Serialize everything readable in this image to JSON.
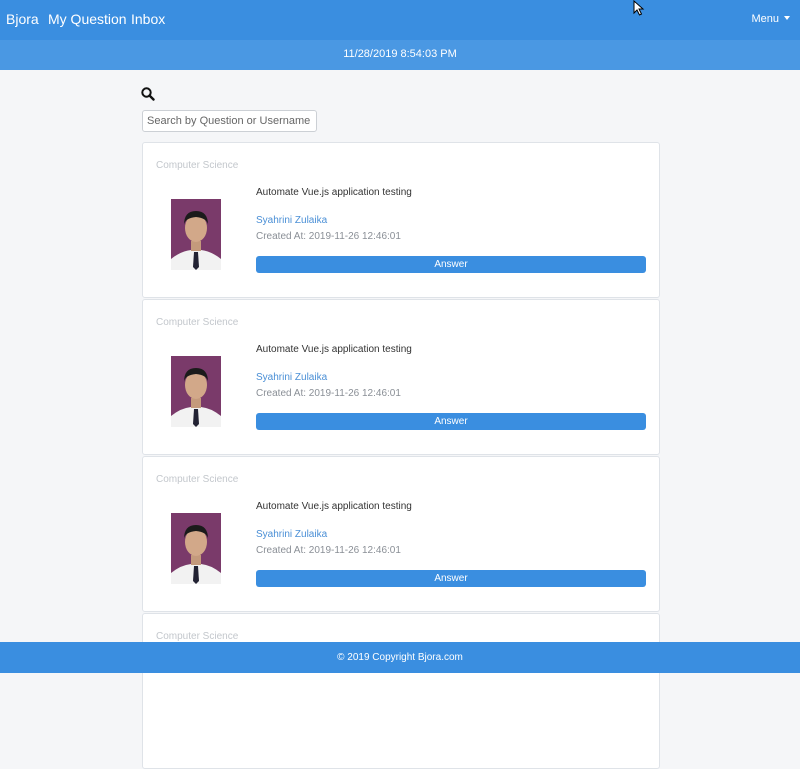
{
  "navbar": {
    "brand": "Bjora",
    "links": [
      "My Question",
      "Inbox"
    ],
    "menu_label": "Menu"
  },
  "datetime": "11/28/2019 8:54:03 PM",
  "search": {
    "icon": "search-icon",
    "placeholder": "Search by Question or Username"
  },
  "questions": [
    {
      "category": "Computer Science",
      "title": "Automate Vue.js application testing",
      "user": "Syahrini Zulaika",
      "created": "Created At: 2019-11-26 12:46:01",
      "answer_label": "Answer"
    },
    {
      "category": "Computer Science",
      "title": "Automate Vue.js application testing",
      "user": "Syahrini Zulaika",
      "created": "Created At: 2019-11-26 12:46:01",
      "answer_label": "Answer"
    },
    {
      "category": "Computer Science",
      "title": "Automate Vue.js application testing",
      "user": "Syahrini Zulaika",
      "created": "Created At: 2019-11-26 12:46:01",
      "answer_label": "Answer"
    },
    {
      "category": "Computer Science"
    }
  ],
  "footer": "© 2019 Copyright Bjora.com",
  "colors": {
    "primary": "#3a8ee0",
    "datebar": "#4a98e3",
    "link": "#4a8fd6",
    "page_bg": "#f5f6f8"
  }
}
